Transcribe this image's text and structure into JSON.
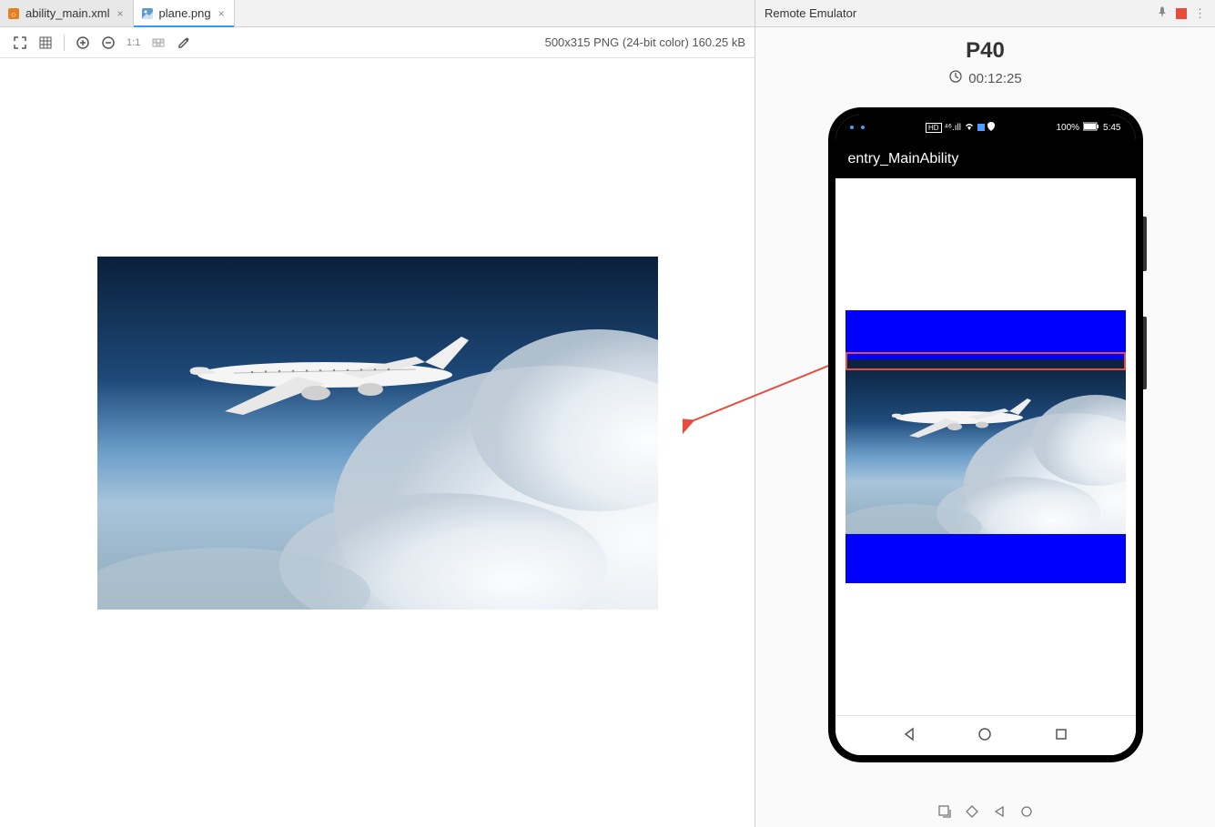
{
  "tabs": [
    {
      "label": "ability_main.xml",
      "icon": "xml-file-icon",
      "active": false
    },
    {
      "label": "plane.png",
      "icon": "image-file-icon",
      "active": true
    }
  ],
  "toolbar": {
    "oneToOne": "1:1",
    "imageInfo": "500x315 PNG (24-bit color) 160.25 kB"
  },
  "emulator": {
    "title": "Remote Emulator",
    "device": "P40",
    "timer": "00:12:25"
  },
  "phone": {
    "statusbar": {
      "battery": "100%",
      "time": "5:45",
      "hd": "HD",
      "signal": "⁴⁶.ıll"
    },
    "appTitle": "entry_MainAbility"
  }
}
